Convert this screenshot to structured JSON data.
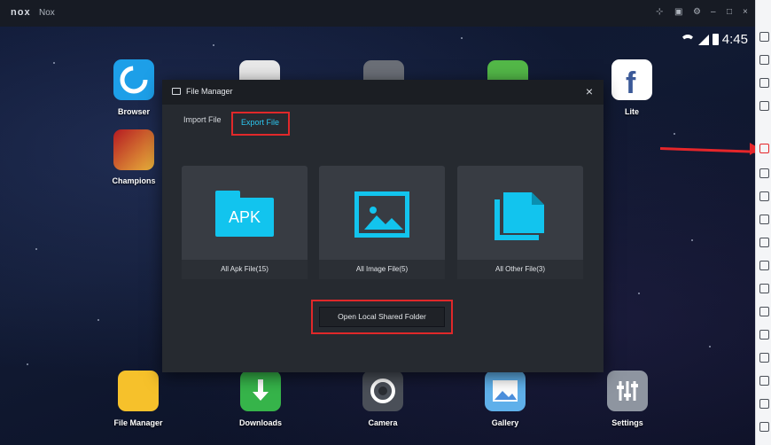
{
  "window": {
    "logo": "nox",
    "title": "Nox",
    "controls": [
      "⊹",
      "▣",
      "⚙",
      "–",
      "□",
      "×"
    ]
  },
  "status": {
    "time": "4:45"
  },
  "desktop": {
    "top_apps": [
      {
        "label": "Browser"
      },
      {
        "label": "Champions"
      },
      {
        "label": "Lite"
      }
    ],
    "dock": [
      {
        "label": "File Manager"
      },
      {
        "label": "Downloads"
      },
      {
        "label": "Camera"
      },
      {
        "label": "Gallery"
      },
      {
        "label": "Settings"
      }
    ]
  },
  "dialog": {
    "title": "File Manager",
    "close": "×",
    "tabs": [
      {
        "label": "Import File",
        "active": false
      },
      {
        "label": "Export File",
        "active": true
      }
    ],
    "cards": [
      {
        "label": "All Apk File(15)",
        "icon": "apk-folder-icon",
        "icon_text": "APK"
      },
      {
        "label": "All Image File(5)",
        "icon": "image-icon"
      },
      {
        "label": "All Other File(3)",
        "icon": "documents-icon"
      }
    ],
    "shared_button": "Open Local Shared Folder"
  },
  "colors": {
    "accent": "#12c4ee",
    "highlight": "#e0282a",
    "dialog_bg": "#262a30"
  }
}
